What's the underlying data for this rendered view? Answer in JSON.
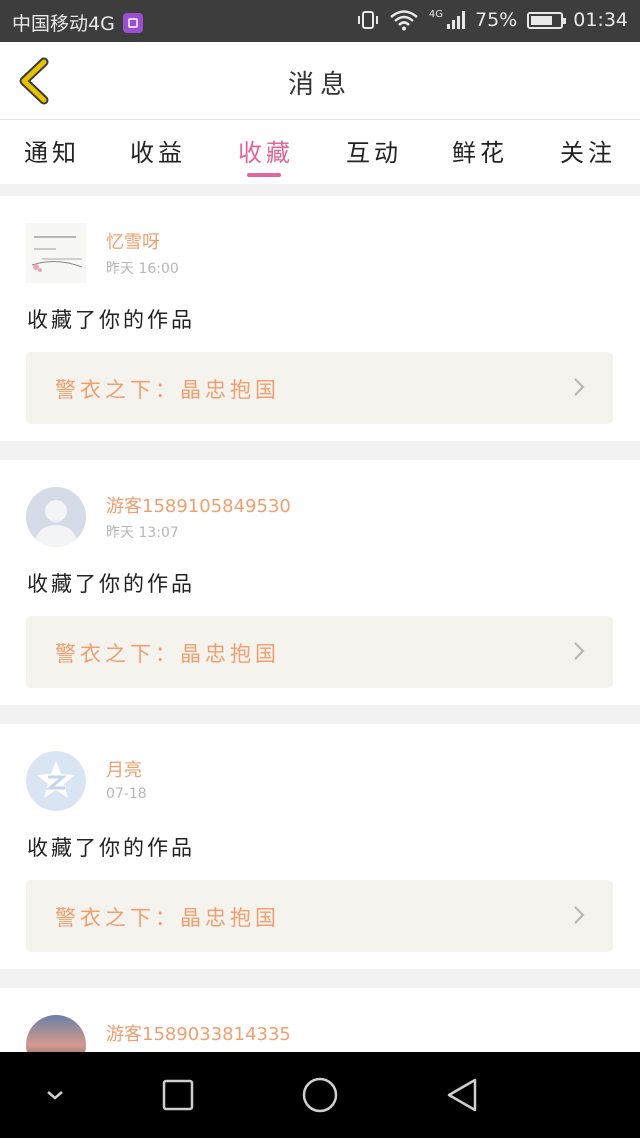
{
  "status_bar": {
    "carrier": "中国移动4G",
    "network": "4G",
    "battery": "75%",
    "battery_level": 75,
    "time": "01:34"
  },
  "header": {
    "title": "消息",
    "back_icon": "chevron-left-icon"
  },
  "tabs": [
    {
      "label": "通知",
      "active": false
    },
    {
      "label": "收益",
      "active": false
    },
    {
      "label": "收藏",
      "active": true
    },
    {
      "label": "互动",
      "active": false
    },
    {
      "label": "鲜花",
      "active": false
    },
    {
      "label": "关注",
      "active": false
    }
  ],
  "messages": [
    {
      "username": "忆雪呀",
      "time": "昨天 16:00",
      "action": "收藏了你的作品",
      "work_title": "警衣之下：晶忠抱国"
    },
    {
      "username": "游客15891058495​30",
      "time": "昨天 13:07",
      "action": "收藏了你的作品",
      "work_title": "警衣之下：晶忠抱国"
    },
    {
      "username": "月亮",
      "time": "07-18",
      "action": "收藏了你的作品",
      "work_title": "警衣之下：晶忠抱国"
    },
    {
      "username": "游客15890338143​35"
    }
  ],
  "colors": {
    "accent": "#e0669c",
    "username": "#f0a070",
    "status_bar": "#3d3d3d",
    "back_icon": "#e6c200"
  }
}
